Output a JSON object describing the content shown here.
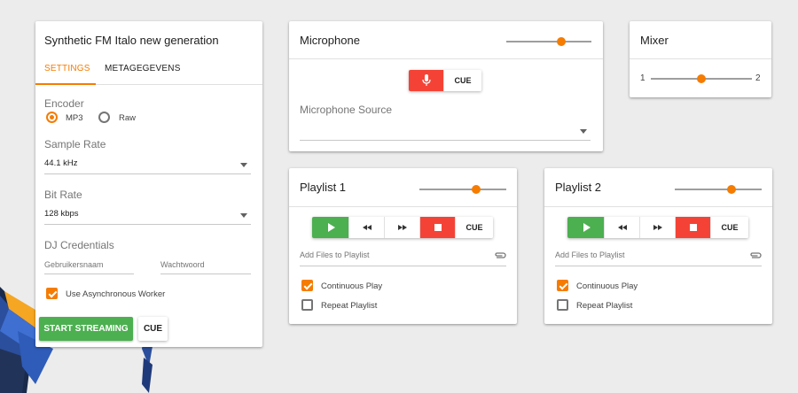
{
  "settings": {
    "title": "Synthetic FM Italo new generation",
    "tabs": [
      "SETTINGS",
      "METAGEGEVENS"
    ],
    "encoder_label": "Encoder",
    "encoder_options": [
      "MP3",
      "Raw"
    ],
    "encoder_selected": "MP3",
    "sample_rate_label": "Sample Rate",
    "sample_rate_value": "44.1 kHz",
    "bit_rate_label": "Bit Rate",
    "bit_rate_value": "128 kbps",
    "dj_label": "DJ Credentials",
    "username_placeholder": "Gebruikersnaam",
    "password_placeholder": "Wachtwoord",
    "async_label": "Use Asynchronous Worker",
    "async_checked": true,
    "start_label": "START STREAMING",
    "cue_label": "CUE"
  },
  "microphone": {
    "title": "Microphone",
    "volume": 0.65,
    "cue_label": "CUE",
    "source_label": "Microphone Source",
    "source_value": ""
  },
  "mixer": {
    "title": "Mixer",
    "left_label": "1",
    "right_label": "2",
    "position": 0.5
  },
  "playlists": [
    {
      "title": "Playlist 1",
      "volume": 0.65,
      "cue_label": "CUE",
      "add_files_label": "Add Files to Playlist",
      "continuous_label": "Continuous Play",
      "continuous_checked": true,
      "repeat_label": "Repeat Playlist",
      "repeat_checked": false
    },
    {
      "title": "Playlist 2",
      "volume": 0.65,
      "cue_label": "CUE",
      "add_files_label": "Add Files to Playlist",
      "continuous_label": "Continuous Play",
      "continuous_checked": true,
      "repeat_label": "Repeat Playlist",
      "repeat_checked": false
    }
  ],
  "colors": {
    "accent": "#f57c00",
    "play": "#4caf50",
    "stop": "#f44336",
    "mic_active": "#f44336"
  },
  "icons": {
    "mic": "mic-icon",
    "play": "play-icon",
    "previous": "fast-rewind-icon",
    "next": "fast-forward-icon",
    "stop": "stop-icon",
    "attach": "paperclip-icon"
  }
}
